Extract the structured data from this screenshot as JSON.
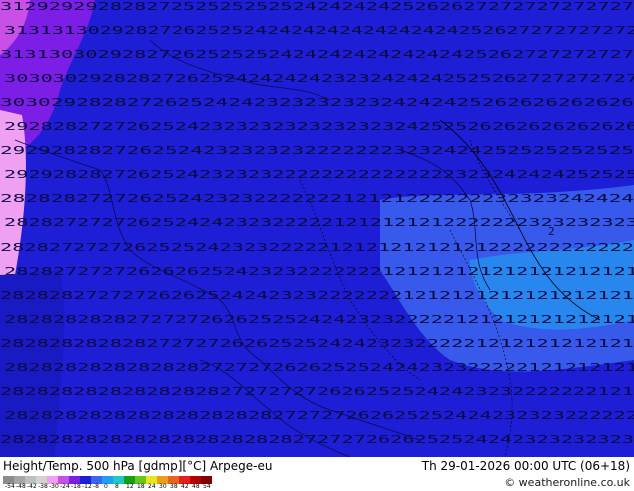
{
  "title": {
    "left": "Height/Temp. 500 hPa [gdmp][°C] Arpege-eu",
    "right": "Th 29-01-2026 00:00 UTC (06+18)"
  },
  "credit": "© weatheronline.co.uk",
  "colorbar": {
    "ticks": [
      "-54",
      "-48",
      "-42",
      "-38",
      "-30",
      "-24",
      "-18",
      "-12",
      "-8",
      "0",
      "8",
      "12",
      "18",
      "24",
      "30",
      "38",
      "42",
      "48",
      "54"
    ],
    "colors": [
      "#8c8c8c",
      "#a5a5a5",
      "#bebebe",
      "#d2d2d2",
      "#f0a0f0",
      "#c850e6",
      "#7d1ee6",
      "#1e1ed6",
      "#3c64f0",
      "#1ea0f0",
      "#1ec8c8",
      "#14a014",
      "#64c81e",
      "#e6e61e",
      "#e6a01e",
      "#e6641e",
      "#e61e1e",
      "#b40000",
      "#800000"
    ]
  },
  "map_labels": {
    "rows": [
      "3129292928282725252525252424242425262627272727272727",
      "31313130292827262525242424242424242424252627272727272",
      "3131303029282726252525242424242424242425262727272727",
      "3030302928282726252424242423232424242525262727272727",
      "30302928282726252424232323232324242425262626262626",
      "2928282727262524232323232323232324252526262626262626",
      "29292828272625242323232322222223232424252525252525",
      "2929282827262524232323222222222222222323242424252525",
      "28282827272625242323222222212121222222232323242424",
      "2828272727262524242323222221212121212222222323232323",
      "2828272727262525242323222221212121212121222222222222",
      "2828272727262626252423232222222121212121212121212121",
      "2828282727272626252424232322222221212121212121212121",
      "2828282828272727262625252424232322222121212121212121",
      "2828282828282727272626252524242323222221212121212121",
      "2828282828282828272727262625252424232322222121212121",
      "2828282828282828282727272726262525242423232222222121",
      "2828282828282828282828272727262625252424232323222222",
      "2828282828282828282828282727272626252524242323232323"
    ]
  },
  "markers": {
    "low_center": "2"
  }
}
